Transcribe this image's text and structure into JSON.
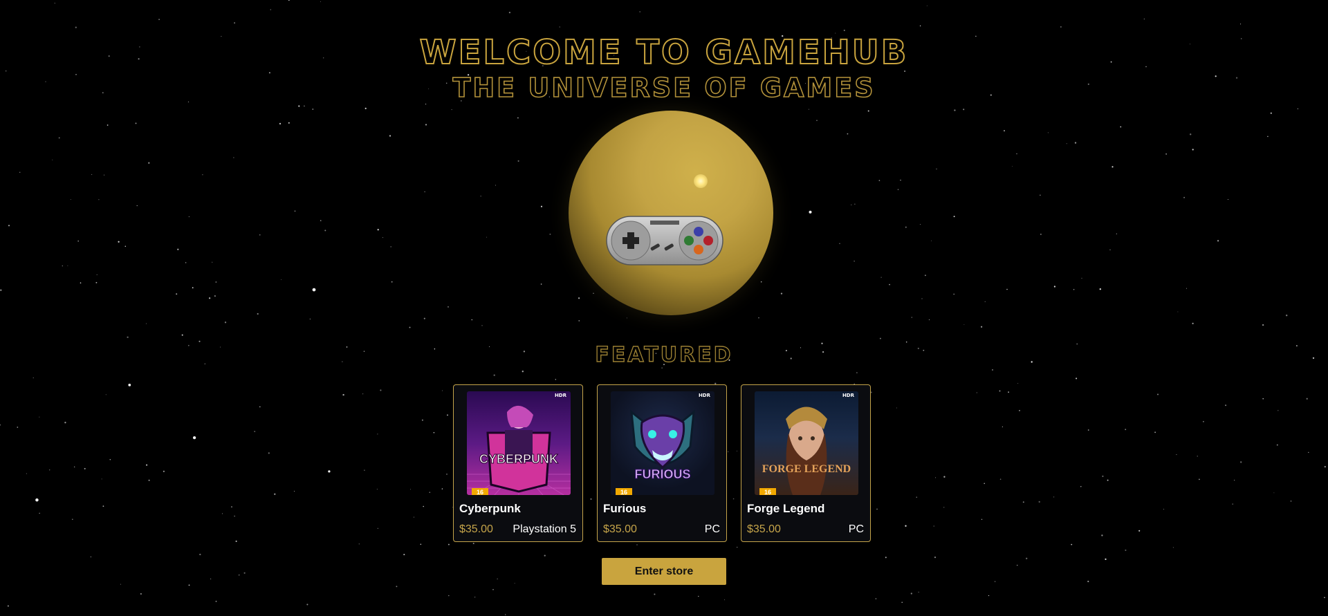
{
  "hero": {
    "title": "WELCOME TO GAMEHUB",
    "subtitle": "THE UNIVERSE OF GAMES"
  },
  "featured": {
    "heading": "FEATURED",
    "games": [
      {
        "name": "Cyberpunk",
        "price": "$35.00",
        "platform": "Playstation 5",
        "cover_title": "CYBERPUNK",
        "rating": "16",
        "hdr": "HDR",
        "cover_colors": [
          "#3a0d6b",
          "#c23aa7"
        ]
      },
      {
        "name": "Furious",
        "price": "$35.00",
        "platform": "PC",
        "cover_title": "FURIOUS",
        "rating": "16",
        "hdr": "HDR",
        "cover_colors": [
          "#0f1530",
          "#8b3fcf"
        ]
      },
      {
        "name": "Forge Legend",
        "price": "$35.00",
        "platform": "PC",
        "cover_title": "FORGE LEGEND",
        "rating": "16",
        "hdr": "HDR",
        "cover_colors": [
          "#0b1a2f",
          "#b8733a"
        ]
      }
    ]
  },
  "cta": {
    "enter_store": "Enter store"
  },
  "colors": {
    "accent": "#c9a43e",
    "background": "#000000"
  }
}
